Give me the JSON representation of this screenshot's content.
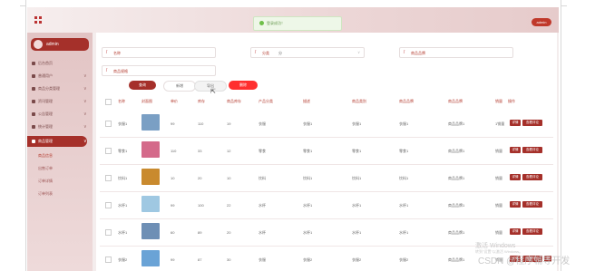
{
  "header": {
    "toast_text": "登录成功！",
    "user_name": "admin"
  },
  "sidebar": {
    "user": "admin",
    "items": [
      {
        "label": "后台首页",
        "chev": ""
      },
      {
        "label": "普通用户",
        "chev": "∨"
      },
      {
        "label": "商品分类管理",
        "chev": "∨"
      },
      {
        "label": "资讯管理",
        "chev": "∨"
      },
      {
        "label": "公告管理",
        "chev": "∨"
      },
      {
        "label": "统计管理",
        "chev": "∨"
      },
      {
        "label": "商品管理",
        "chev": "∨"
      }
    ],
    "subitems": [
      "商品信息",
      "出售订单",
      "订单详情",
      "订单列表"
    ]
  },
  "search": {
    "name_label": "名称",
    "name_placeholder": "名称",
    "category_label": "分类",
    "category_value": "分",
    "spec_placeholder": "商品规格",
    "brand_placeholder": "商品品牌",
    "query_btn": "查询",
    "add_btn": "新增",
    "export_btn": "导出",
    "delete_btn": "删除"
  },
  "table": {
    "headers": [
      "名称",
      "封面图",
      "单价",
      "库存",
      "商品库存",
      "产品分类",
      "描述",
      "商品类别",
      "商品品牌",
      "商品品牌",
      "销量",
      "操作"
    ],
    "rows": [
      {
        "name": "衣服1",
        "price": "99",
        "stock": "110",
        "qty": "19",
        "cat": "衣服",
        "desc": "衣服1",
        "type": "衣服1",
        "brand1": "衣服1",
        "brand2": "商品品牌1",
        "sales": "1销量",
        "thumb": "#7a9fc4"
      },
      {
        "name": "零食1",
        "price": "110",
        "stock": "33",
        "qty": "12",
        "cat": "零食",
        "desc": "零食1",
        "type": "零食1",
        "brand1": "零食1",
        "brand2": "商品品牌1",
        "sales": "销量",
        "thumb": "#d46a8a"
      },
      {
        "name": "饮料1",
        "price": "10",
        "stock": "20",
        "qty": "10",
        "cat": "饮料",
        "desc": "饮料1",
        "type": "饮料1",
        "brand1": "饮料1",
        "brand2": "商品品牌1",
        "sales": "销量",
        "thumb": "#c98a2e"
      },
      {
        "name": "水杯1",
        "price": "99",
        "stock": "100",
        "qty": "22",
        "cat": "水杯",
        "desc": "水杯1",
        "type": "水杯1",
        "brand1": "水杯1",
        "brand2": "商品品牌1",
        "sales": "销量",
        "thumb": "#9fc8e2"
      },
      {
        "name": "水杯1",
        "price": "60",
        "stock": "89",
        "qty": "20",
        "cat": "水杯",
        "desc": "水杯1",
        "type": "水杯1",
        "brand1": "水杯1",
        "brand2": "商品品牌1",
        "sales": "销量",
        "thumb": "#6e8fb5"
      },
      {
        "name": "衣服2",
        "price": "99",
        "stock": "87",
        "qty": "30",
        "cat": "衣服",
        "desc": "衣服2",
        "type": "衣服2",
        "brand1": "衣服2",
        "brand2": "商品品牌1",
        "sales": "销量",
        "thumb": "#6aa3d6"
      }
    ],
    "detail_btn": "详情",
    "view_btn": "查看评论",
    "del_btn": "删"
  },
  "watermark": {
    "line1": "激活 Windows",
    "line2": "转到\"设置\"以激活 Windows。"
  },
  "csdn": "CSDN @程序辅导开发",
  "colors": {
    "accent": "#a5302a",
    "danger": "#ff2f2f",
    "toast_bg": "#eef7e8"
  }
}
